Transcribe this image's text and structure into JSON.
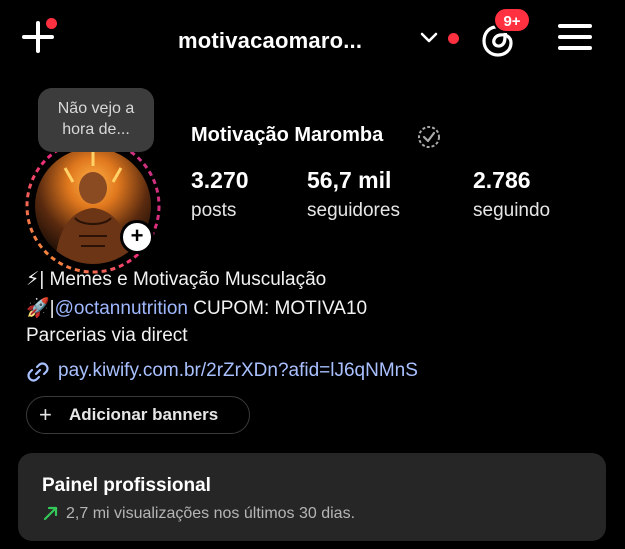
{
  "header": {
    "username": "motivacaomaro...",
    "notification_badge": "9+"
  },
  "profile": {
    "note": "Não vejo a hora de...",
    "display_name": "Motivação Maromba",
    "stats": [
      {
        "value": "3.270",
        "label": "posts"
      },
      {
        "value": "56,7 mil",
        "label": "seguidores"
      },
      {
        "value": "2.786",
        "label": "seguindo"
      }
    ]
  },
  "bio": {
    "line1_emoji": "⚡",
    "line1_text": "| Memes e Motivação Musculação",
    "line2_emoji": "🚀",
    "line2_sep": "|",
    "line2_mention": "@octannutrition",
    "line2_text": " CUPOM: MOTIVA10",
    "line3": "Parcerias via direct",
    "link": "pay.kiwify.com.br/2rZrXDn?afid=lJ6qNMnS"
  },
  "banners": {
    "add_label": "Adicionar banners"
  },
  "dashboard": {
    "title": "Painel profissional",
    "subtitle": "2,7 mi visualizações nos últimos 30 dias."
  },
  "icons": {
    "create": "plus-icon",
    "chevron": "chevron-down-icon",
    "threads": "threads-icon",
    "menu": "hamburger-menu-icon",
    "verified": "verified-badge-icon",
    "link": "link-icon",
    "trend": "trend-up-arrow-icon"
  },
  "colors": {
    "background": "#000000",
    "notification_red": "#ff3040",
    "link_blue": "#a9c0ff",
    "trend_green": "#34c759",
    "panel": "#262626"
  }
}
